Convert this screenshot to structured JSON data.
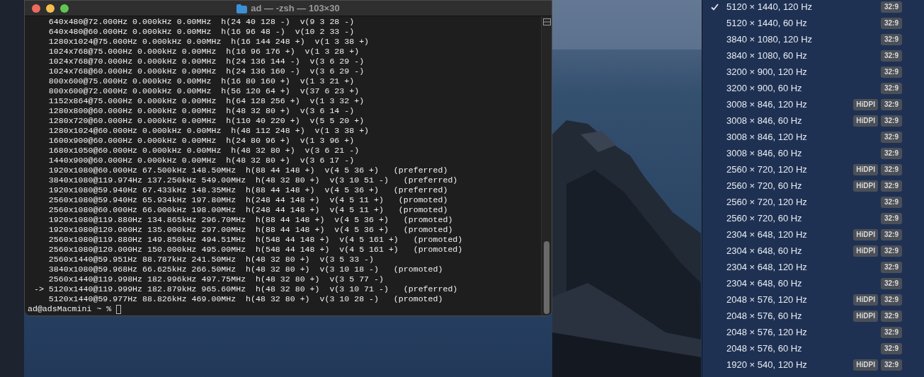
{
  "terminal": {
    "title": "ad — -zsh — 103×30",
    "lines": [
      "    640x480@72.000Hz 0.000kHz 0.00MHz  h(24 40 128 -)  v(9 3 28 -)",
      "    640x480@60.000Hz 0.000kHz 0.00MHz  h(16 96 48 -)  v(10 2 33 -)",
      "    1280x1024@75.000Hz 0.000kHz 0.00MHz  h(16 144 248 +)  v(1 3 38 +)",
      "    1024x768@75.000Hz 0.000kHz 0.00MHz  h(16 96 176 +)  v(1 3 28 +)",
      "    1024x768@70.000Hz 0.000kHz 0.00MHz  h(24 136 144 -)  v(3 6 29 -)",
      "    1024x768@60.000Hz 0.000kHz 0.00MHz  h(24 136 160 -)  v(3 6 29 -)",
      "    800x600@75.000Hz 0.000kHz 0.00MHz  h(16 80 160 +)  v(1 3 21 +)",
      "    800x600@72.000Hz 0.000kHz 0.00MHz  h(56 120 64 +)  v(37 6 23 +)",
      "    1152x864@75.000Hz 0.000kHz 0.00MHz  h(64 128 256 +)  v(1 3 32 +)",
      "    1280x800@60.000Hz 0.000kHz 0.00MHz  h(48 32 80 +)  v(3 6 14 -)",
      "    1280x720@60.000Hz 0.000kHz 0.00MHz  h(110 40 220 +)  v(5 5 20 +)",
      "    1280x1024@60.000Hz 0.000kHz 0.00MHz  h(48 112 248 +)  v(1 3 38 +)",
      "    1600x900@60.000Hz 0.000kHz 0.00MHz  h(24 80 96 +)  v(1 3 96 +)",
      "    1680x1050@60.000Hz 0.000kHz 0.00MHz  h(48 32 80 +)  v(3 6 21 -)",
      "    1440x900@60.000Hz 0.000kHz 0.00MHz  h(48 32 80 +)  v(3 6 17 -)",
      "    1920x1080@60.000Hz 67.500kHz 148.50MHz  h(88 44 148 +)  v(4 5 36 +)   (preferred)",
      "    3840x1080@119.974Hz 137.250kHz 549.00MHz  h(48 32 80 +)  v(3 10 51 -)   (preferred)",
      "    1920x1080@59.940Hz 67.433kHz 148.35MHz  h(88 44 148 +)  v(4 5 36 +)   (preferred)",
      "    2560x1080@59.940Hz 65.934kHz 197.80MHz  h(248 44 148 +)  v(4 5 11 +)   (promoted)",
      "    2560x1080@60.000Hz 66.000kHz 198.00MHz  h(248 44 148 +)  v(4 5 11 +)   (promoted)",
      "    1920x1080@119.880Hz 134.865kHz 296.70MHz  h(88 44 148 +)  v(4 5 36 +)   (promoted)",
      "    1920x1080@120.000Hz 135.000kHz 297.00MHz  h(88 44 148 +)  v(4 5 36 +)   (promoted)",
      "    2560x1080@119.880Hz 149.850kHz 494.51MHz  h(548 44 148 +)  v(4 5 161 +)   (promoted)",
      "    2560x1080@120.000Hz 150.000kHz 495.00MHz  h(548 44 148 +)  v(4 5 161 +)   (promoted)",
      "    2560x1440@59.951Hz 88.787kHz 241.50MHz  h(48 32 80 +)  v(3 5 33 -)",
      "    3840x1080@59.968Hz 66.625kHz 266.50MHz  h(48 32 80 +)  v(3 10 18 -)   (promoted)",
      "    2560x1440@119.998Hz 182.996kHz 497.75MHz  h(48 32 80 +)  v(3 5 77 -)",
      " -> 5120x1440@119.999Hz 182.879kHz 965.60MHz  h(48 32 80 +)  v(3 10 71 -)   (preferred)",
      "    5120x1440@59.977Hz 88.826kHz 469.00MHz  h(48 32 80 +)  v(3 10 28 -)   (promoted)"
    ],
    "prompt": "ad@adsMacmini ~ %"
  },
  "resolution_menu": {
    "items": [
      {
        "label": "5120 × 1440, 120 Hz",
        "checked": true,
        "badges": [
          "32:9"
        ]
      },
      {
        "label": "5120 × 1440, 60 Hz",
        "checked": false,
        "badges": [
          "32:9"
        ]
      },
      {
        "label": "3840 × 1080, 120 Hz",
        "checked": false,
        "badges": [
          "32:9"
        ]
      },
      {
        "label": "3840 × 1080, 60 Hz",
        "checked": false,
        "badges": [
          "32:9"
        ]
      },
      {
        "label": "3200 × 900, 120 Hz",
        "checked": false,
        "badges": [
          "32:9"
        ]
      },
      {
        "label": "3200 × 900, 60 Hz",
        "checked": false,
        "badges": [
          "32:9"
        ]
      },
      {
        "label": "3008 × 846, 120 Hz",
        "checked": false,
        "badges": [
          "HiDPI",
          "32:9"
        ]
      },
      {
        "label": "3008 × 846, 60 Hz",
        "checked": false,
        "badges": [
          "HiDPI",
          "32:9"
        ]
      },
      {
        "label": "3008 × 846, 120 Hz",
        "checked": false,
        "badges": [
          "32:9"
        ]
      },
      {
        "label": "3008 × 846, 60 Hz",
        "checked": false,
        "badges": [
          "32:9"
        ]
      },
      {
        "label": "2560 × 720, 120 Hz",
        "checked": false,
        "badges": [
          "HiDPI",
          "32:9"
        ]
      },
      {
        "label": "2560 × 720, 60 Hz",
        "checked": false,
        "badges": [
          "HiDPI",
          "32:9"
        ]
      },
      {
        "label": "2560 × 720, 120 Hz",
        "checked": false,
        "badges": [
          "32:9"
        ]
      },
      {
        "label": "2560 × 720, 60 Hz",
        "checked": false,
        "badges": [
          "32:9"
        ]
      },
      {
        "label": "2304 × 648, 120 Hz",
        "checked": false,
        "badges": [
          "HiDPI",
          "32:9"
        ]
      },
      {
        "label": "2304 × 648, 60 Hz",
        "checked": false,
        "badges": [
          "HiDPI",
          "32:9"
        ]
      },
      {
        "label": "2304 × 648, 120 Hz",
        "checked": false,
        "badges": [
          "32:9"
        ]
      },
      {
        "label": "2304 × 648, 60 Hz",
        "checked": false,
        "badges": [
          "32:9"
        ]
      },
      {
        "label": "2048 × 576, 120 Hz",
        "checked": false,
        "badges": [
          "HiDPI",
          "32:9"
        ]
      },
      {
        "label": "2048 × 576, 60 Hz",
        "checked": false,
        "badges": [
          "HiDPI",
          "32:9"
        ]
      },
      {
        "label": "2048 × 576, 120 Hz",
        "checked": false,
        "badges": [
          "32:9"
        ]
      },
      {
        "label": "2048 × 576, 60 Hz",
        "checked": false,
        "badges": [
          "32:9"
        ]
      },
      {
        "label": "1920 × 540, 120 Hz",
        "checked": false,
        "badges": [
          "HiDPI",
          "32:9"
        ]
      }
    ]
  }
}
